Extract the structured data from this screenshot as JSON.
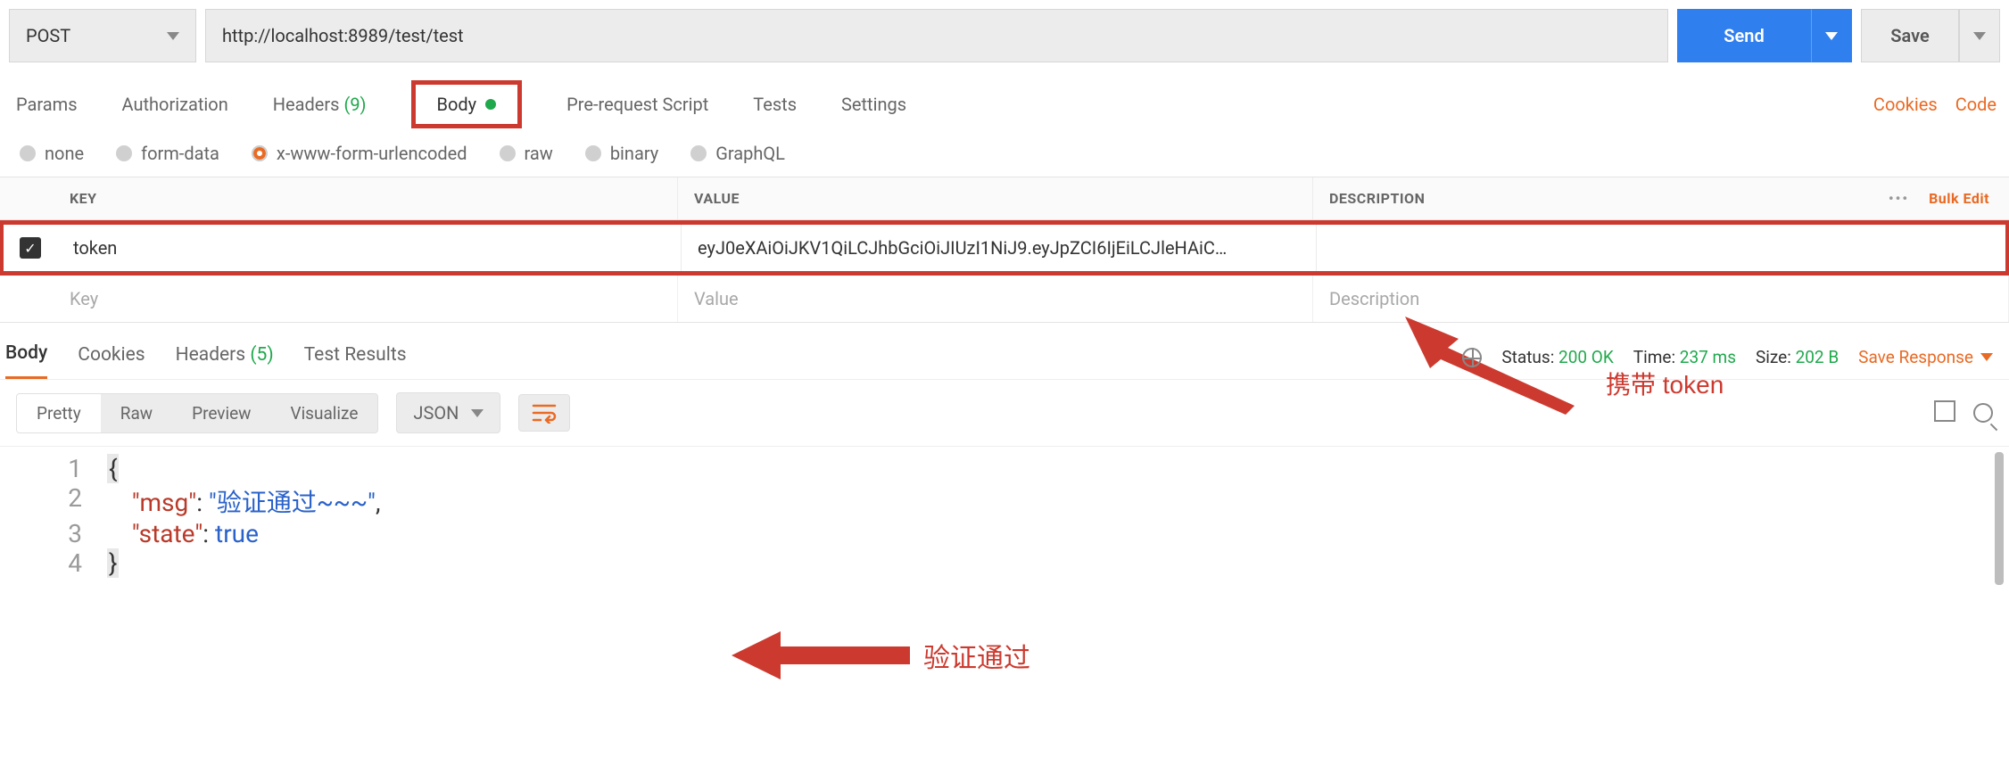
{
  "request": {
    "method": "POST",
    "url": "http://localhost:8989/test/test",
    "send_label": "Send",
    "save_label": "Save"
  },
  "req_tabs": {
    "params": "Params",
    "authorization": "Authorization",
    "headers_label": "Headers",
    "headers_count": "(9)",
    "body": "Body",
    "prerequest": "Pre-request Script",
    "tests": "Tests",
    "settings": "Settings"
  },
  "right_links": {
    "cookies": "Cookies",
    "code": "Code"
  },
  "body_types": {
    "none": "none",
    "formdata": "form-data",
    "xwww": "x-www-form-urlencoded",
    "raw": "raw",
    "binary": "binary",
    "graphql": "GraphQL"
  },
  "param_headers": {
    "key": "KEY",
    "value": "VALUE",
    "description": "DESCRIPTION",
    "bulk_edit": "Bulk Edit"
  },
  "params": [
    {
      "enabled": true,
      "key": "token",
      "value": "eyJ0eXAiOiJKV1QiLCJhbGciOiJIUzI1NiJ9.eyJpZCI6IjEiLCJleHAiC…",
      "description": ""
    }
  ],
  "param_placeholder": {
    "key": "Key",
    "value": "Value",
    "description": "Description"
  },
  "annotation1": "携带 token",
  "response_tabs": {
    "body": "Body",
    "cookies": "Cookies",
    "headers_label": "Headers",
    "headers_count": "(5)",
    "test_results": "Test Results"
  },
  "response_meta": {
    "status_label": "Status:",
    "status_value": "200 OK",
    "time_label": "Time:",
    "time_value": "237 ms",
    "size_label": "Size:",
    "size_value": "202 B",
    "save_response": "Save Response"
  },
  "pretty_bar": {
    "pretty": "Pretty",
    "raw": "Raw",
    "preview": "Preview",
    "visualize": "Visualize",
    "format": "JSON"
  },
  "response_body": {
    "lines": [
      "1",
      "2",
      "3",
      "4"
    ],
    "msg_key": "\"msg\"",
    "msg_val": "\"验证通过~~~\"",
    "state_key": "\"state\"",
    "state_val": "true"
  },
  "annotation2": "验证通过",
  "chart_data": {
    "type": "table",
    "title": "HTTP response JSON body",
    "columns": [
      "key",
      "value"
    ],
    "rows": [
      [
        "msg",
        "验证通过~~~"
      ],
      [
        "state",
        true
      ]
    ]
  }
}
